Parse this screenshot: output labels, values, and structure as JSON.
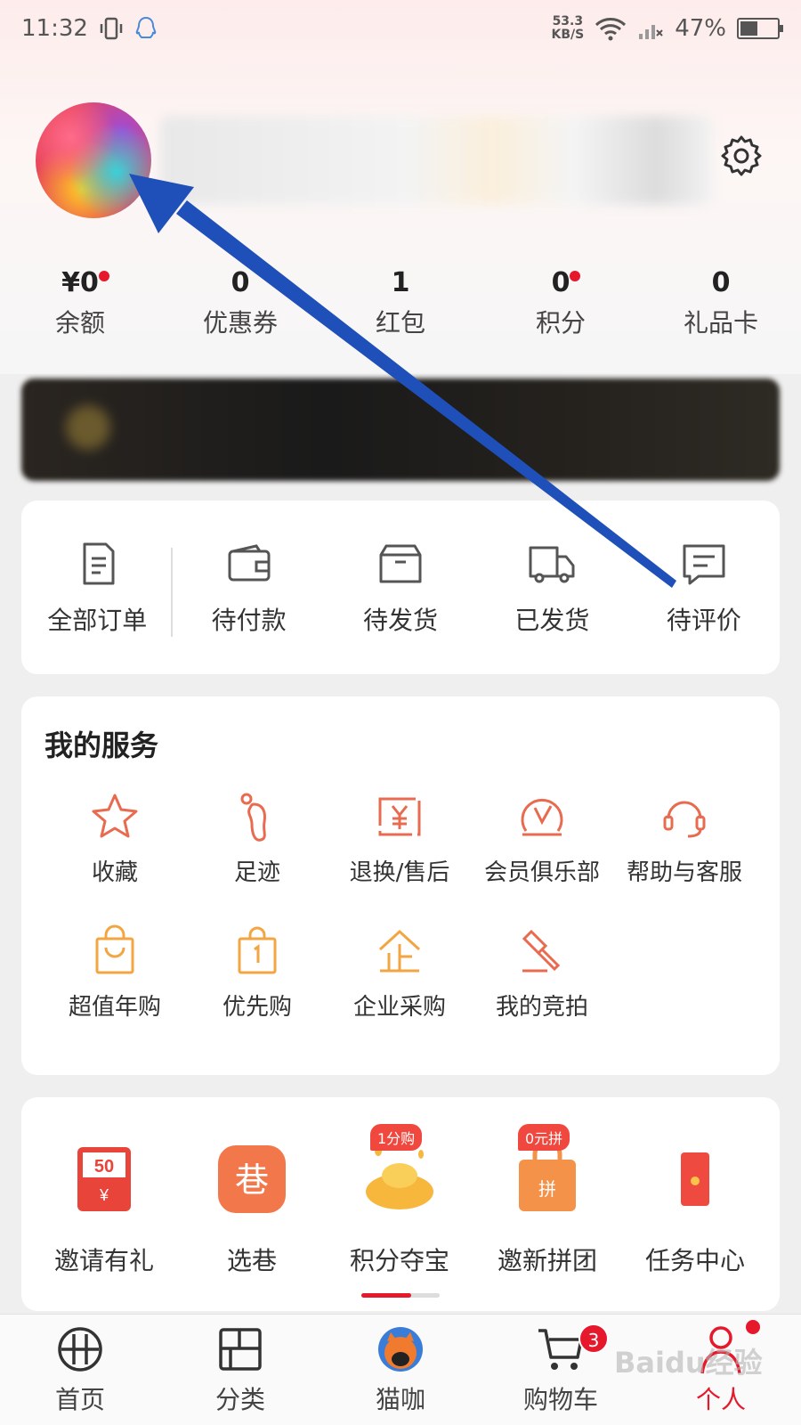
{
  "status_bar": {
    "time": "11:32",
    "net_speed_value": "53.3",
    "net_speed_unit": "KB/S",
    "battery": "47%",
    "battery_level": 0.47
  },
  "stats": [
    {
      "value": "¥0",
      "label": "余额",
      "dot": true
    },
    {
      "value": "0",
      "label": "优惠券",
      "dot": false
    },
    {
      "value": "1",
      "label": "红包",
      "dot": false
    },
    {
      "value": "0",
      "label": "积分",
      "dot": true
    },
    {
      "value": "0",
      "label": "礼品卡",
      "dot": false
    }
  ],
  "orders": [
    {
      "label": "全部订单",
      "icon": "order-list-icon"
    },
    {
      "label": "待付款",
      "icon": "wallet-icon"
    },
    {
      "label": "待发货",
      "icon": "box-icon"
    },
    {
      "label": "已发货",
      "icon": "truck-icon"
    },
    {
      "label": "待评价",
      "icon": "comment-icon"
    }
  ],
  "services": {
    "title": "我的服务",
    "items": [
      {
        "label": "收藏",
        "icon": "star-icon"
      },
      {
        "label": "足迹",
        "icon": "footprint-icon"
      },
      {
        "label": "退换/售后",
        "icon": "refund-icon"
      },
      {
        "label": "会员俱乐部",
        "icon": "vip-icon"
      },
      {
        "label": "帮助与客服",
        "icon": "headset-icon"
      },
      {
        "label": "超值年购",
        "icon": "shopping-bag-icon"
      },
      {
        "label": "优先购",
        "icon": "priority-bag-icon"
      },
      {
        "label": "企业采购",
        "icon": "enterprise-icon"
      },
      {
        "label": "我的竞拍",
        "icon": "auction-icon"
      }
    ]
  },
  "promo": {
    "items": [
      {
        "label": "邀请有礼",
        "icon": "red-envelope-50-icon",
        "icon_text": "50",
        "icon_sub": "¥",
        "badge": ""
      },
      {
        "label": "选巷",
        "icon": "lane-icon",
        "icon_text": "巷",
        "badge": ""
      },
      {
        "label": "积分夺宝",
        "icon": "gold-ingot-icon",
        "badge": "1分购"
      },
      {
        "label": "邀新拼团",
        "icon": "group-buy-bag-icon",
        "icon_text": "拼",
        "badge": "0元拼"
      },
      {
        "label": "任务中心",
        "icon": "task-envelope-icon",
        "badge": ""
      }
    ],
    "scroll_progress": 0.64
  },
  "bottom_nav": [
    {
      "label": "首页",
      "icon": "home-icon",
      "active": false
    },
    {
      "label": "分类",
      "icon": "category-icon",
      "active": false
    },
    {
      "label": "猫咖",
      "icon": "cat-cafe-icon",
      "active": false
    },
    {
      "label": "购物车",
      "icon": "cart-icon",
      "active": false,
      "badge": "3"
    },
    {
      "label": "个人",
      "icon": "person-icon",
      "active": true
    }
  ],
  "watermark": "Baidu经验",
  "colors": {
    "accent": "#e5192b",
    "service_icon": "#e86a4f",
    "service_icon_alt": "#f2a541",
    "arrow": "#1f4fb8"
  }
}
